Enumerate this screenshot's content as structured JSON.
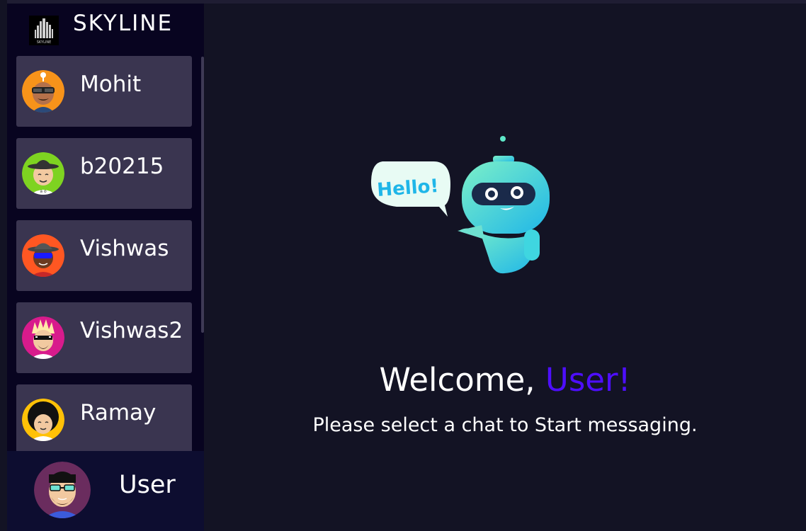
{
  "app": {
    "brand_name": "SKYLINE",
    "brand_logo_text": "SKYLINE"
  },
  "contacts": [
    {
      "name": "Mohit",
      "avatar_color": "#f7931a",
      "avatar_icon": "avatar-mohit-icon"
    },
    {
      "name": "b20215",
      "avatar_color": "#7ed321",
      "avatar_icon": "avatar-b20215-icon"
    },
    {
      "name": "Vishwas",
      "avatar_color": "#ff5722",
      "avatar_icon": "avatar-vishwas-icon"
    },
    {
      "name": "Vishwas2",
      "avatar_color": "#d81b8c",
      "avatar_icon": "avatar-vishwas2-icon"
    },
    {
      "name": "Ramay",
      "avatar_color": "#ffc107",
      "avatar_icon": "avatar-ramay-icon"
    }
  ],
  "current_user": {
    "name": "User",
    "avatar_color": "#6a2c5e",
    "avatar_icon": "avatar-user-icon"
  },
  "welcome": {
    "greeting": "Welcome, ",
    "username": "User!",
    "subtitle": "Please select a chat to Start messaging.",
    "robot_bubble_text": "Hello!"
  },
  "colors": {
    "background": "#131324",
    "sidebar": "#080420",
    "contact_card": "#3a3550",
    "current_user_bar": "#0d0d30",
    "accent": "#4e0eff"
  }
}
